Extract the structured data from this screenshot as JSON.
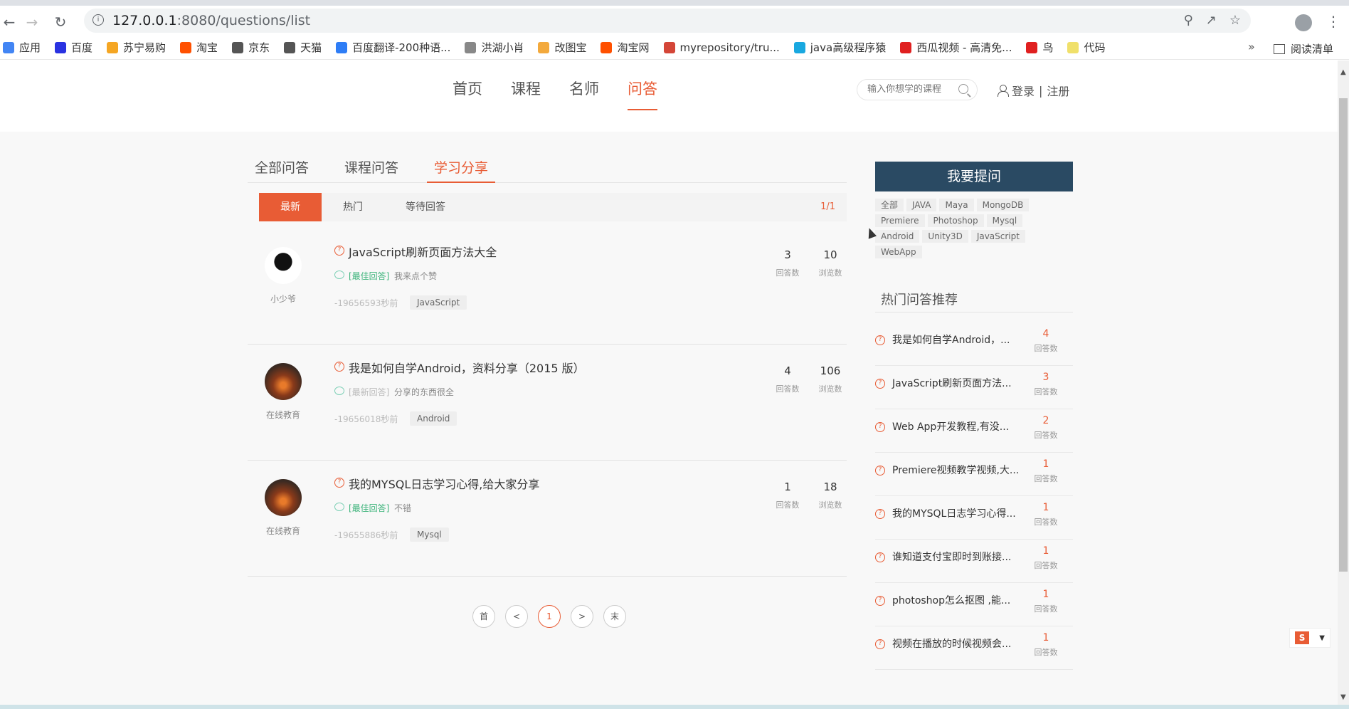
{
  "browser": {
    "url_host": "127.0.0.1",
    "url_path": ":8080/questions/list",
    "bookmarks": [
      {
        "label": "应用",
        "color": "#4285f4"
      },
      {
        "label": "百度",
        "color": "#2932e1"
      },
      {
        "label": "苏宁易购",
        "color": "#f5a623"
      },
      {
        "label": "淘宝",
        "color": "#ff5000"
      },
      {
        "label": "京东",
        "color": "#555555"
      },
      {
        "label": "天猫",
        "color": "#555555"
      },
      {
        "label": "百度翻译-200种语...",
        "color": "#2e7df6"
      },
      {
        "label": "洪湖小肖",
        "color": "#888888"
      },
      {
        "label": "改图宝",
        "color": "#f3a93c"
      },
      {
        "label": "淘宝网",
        "color": "#ff5000"
      },
      {
        "label": "myrepository/tru...",
        "color": "#d44638"
      },
      {
        "label": "java高级程序猿",
        "color": "#19a8e0"
      },
      {
        "label": "西瓜视频 - 高清免...",
        "color": "#e02020"
      },
      {
        "label": "鸟",
        "color": "#e02020"
      },
      {
        "label": "代码",
        "color": "#f0e06a"
      }
    ],
    "more": "»",
    "reading_list": "阅读清单"
  },
  "header": {
    "nav": [
      {
        "label": "首页",
        "active": false
      },
      {
        "label": "课程",
        "active": false
      },
      {
        "label": "名师",
        "active": false
      },
      {
        "label": "问答",
        "active": true
      }
    ],
    "search_placeholder": "输入你想学的课程",
    "login": "登录",
    "separator": "|",
    "register": "注册"
  },
  "tabs": {
    "items": [
      "全部问答",
      "课程问答",
      "学习分享"
    ],
    "active_index": 2
  },
  "filter": {
    "items": [
      "最新",
      "热门",
      "等待回答"
    ],
    "active_index": 0,
    "page_count": "1/1"
  },
  "questions": [
    {
      "author": "小少爷",
      "title": "JavaScript刷新页面方法大全",
      "answer_label": "[最佳回答]",
      "answer_type": "best",
      "answer_text": "我来点个赞",
      "time": "-19656593秒前",
      "tag": "JavaScript",
      "answers": "3",
      "answers_label": "回答数",
      "views": "10",
      "views_label": "浏览数"
    },
    {
      "author": "在线教育",
      "title": "我是如何自学Android，资料分享（2015 版）",
      "answer_label": "[最新回答]",
      "answer_type": "newest",
      "answer_text": "分享的东西很全",
      "time": "-19656018秒前",
      "tag": "Android",
      "answers": "4",
      "answers_label": "回答数",
      "views": "106",
      "views_label": "浏览数"
    },
    {
      "author": "在线教育",
      "title": "我的MYSQL日志学习心得,给大家分享",
      "answer_label": "[最佳回答]",
      "answer_type": "best",
      "answer_text": "不错",
      "time": "-19655886秒前",
      "tag": "Mysql",
      "answers": "1",
      "answers_label": "回答数",
      "views": "18",
      "views_label": "浏览数"
    }
  ],
  "pagination": [
    "首",
    "<",
    "1",
    ">",
    "末"
  ],
  "sidebar": {
    "ask_button": "我要提问",
    "tags": [
      "全部",
      "JAVA",
      "Maya",
      "MongoDB",
      "Premiere",
      "Photoshop",
      "Mysql",
      "Android",
      "Unity3D",
      "JavaScript",
      "WebApp"
    ],
    "hot_title": "热门问答推荐",
    "hot_items": [
      {
        "text": "我是如何自学Android，...",
        "count": "4",
        "label": "回答数"
      },
      {
        "text": "JavaScript刷新页面方法...",
        "count": "3",
        "label": "回答数"
      },
      {
        "text": "Web App开发教程,有没...",
        "count": "2",
        "label": "回答数"
      },
      {
        "text": "Premiere视频教学视频,大...",
        "count": "1",
        "label": "回答数"
      },
      {
        "text": "我的MYSQL日志学习心得...",
        "count": "1",
        "label": "回答数"
      },
      {
        "text": "谁知道支付宝即时到账接...",
        "count": "1",
        "label": "回答数"
      },
      {
        "text": "photoshop怎么抠图 ,能...",
        "count": "1",
        "label": "回答数"
      },
      {
        "text": "视频在播放的时候视频会...",
        "count": "1",
        "label": "回答数"
      }
    ]
  },
  "widget_label": "S"
}
